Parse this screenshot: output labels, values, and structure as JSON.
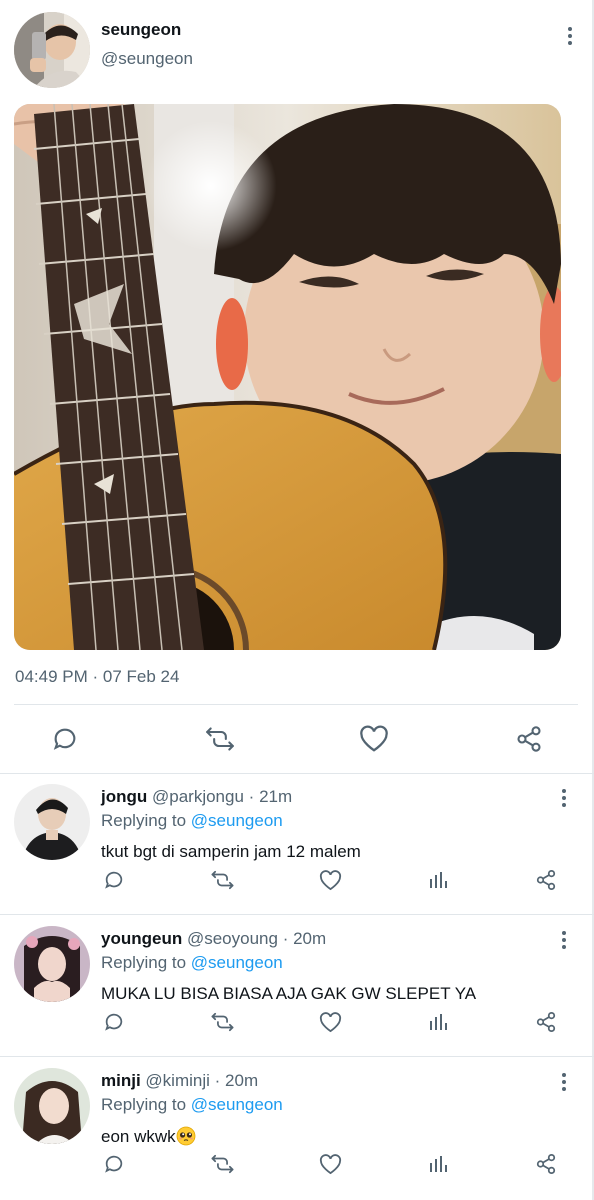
{
  "main_tweet": {
    "display_name": "seungeon",
    "handle": "@seungeon",
    "timestamp": "04:49 PM · 07 Feb 24",
    "actions": [
      "reply-icon",
      "retweet-icon",
      "like-icon",
      "share-icon"
    ]
  },
  "replies": [
    {
      "display_name": "jongu",
      "handle": "@parkjongu",
      "time": "21m",
      "replying_prefix": "Replying to",
      "replying_to": "@seungeon",
      "text": "tkut bgt di samperin jam 12 malem",
      "emoji": ""
    },
    {
      "display_name": "youngeun",
      "handle": "@seoyoung",
      "time": "20m",
      "replying_prefix": "Replying to",
      "replying_to": "@seungeon",
      "text": "MUKA LU BISA BIASA AJA GAK GW SLEPET YA",
      "emoji": ""
    },
    {
      "display_name": "minji",
      "handle": "@kiminji",
      "time": "20m",
      "replying_prefix": "Replying to",
      "replying_to": "@seungeon",
      "text": "eon wkwk",
      "emoji": "pleading-face"
    }
  ],
  "separator": "·",
  "colors": {
    "text": "#0f1419",
    "secondary": "#536471",
    "link": "#1d9bf0",
    "divider": "#e1e6ea"
  }
}
